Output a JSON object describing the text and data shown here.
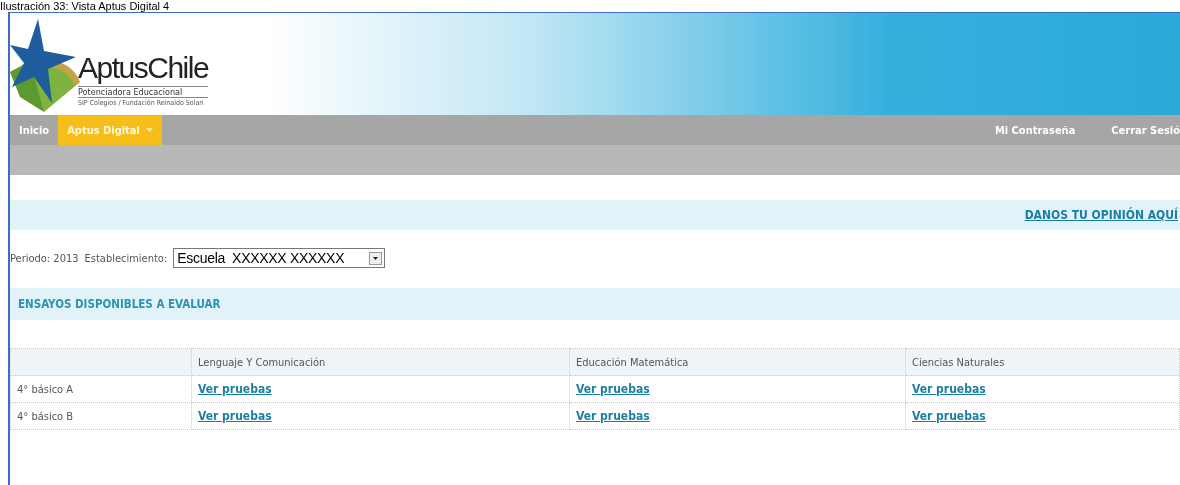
{
  "caption": "Ilustración 33: Vista Aptus Digital 4",
  "logo": {
    "name": "AptusChile",
    "tagline": "Potenciadora Educacional",
    "subtitle": "SIP Colegios / Fundación Reinaldo Solari"
  },
  "nav": {
    "left": [
      {
        "label": "Inicio",
        "selected": false,
        "dropdown": false
      },
      {
        "label": "Aptus Digital",
        "selected": true,
        "dropdown": true
      }
    ],
    "right": [
      {
        "label": "Mi Contraseña"
      },
      {
        "label": "Cerrar Sesió"
      }
    ]
  },
  "feedback_link": "DANOS TU OPINIÓN AQUÍ",
  "filters": {
    "period": "Periodo: 2013",
    "school_label": "Establecimiento:",
    "school_value": "Escuela  XXXXXX XXXXXX"
  },
  "section_title": "ENSAYOS DISPONIBLES A EVALUAR",
  "table": {
    "columns": [
      "Lenguaje Y Comunicación",
      "Educación Matemática",
      "Ciencias Naturales"
    ],
    "rows": [
      {
        "label": "4° básico A",
        "cells": [
          "Ver pruebas",
          "Ver pruebas",
          "Ver pruebas"
        ]
      },
      {
        "label": "4° básico B",
        "cells": [
          "Ver pruebas",
          "Ver pruebas",
          "Ver pruebas"
        ]
      }
    ]
  }
}
